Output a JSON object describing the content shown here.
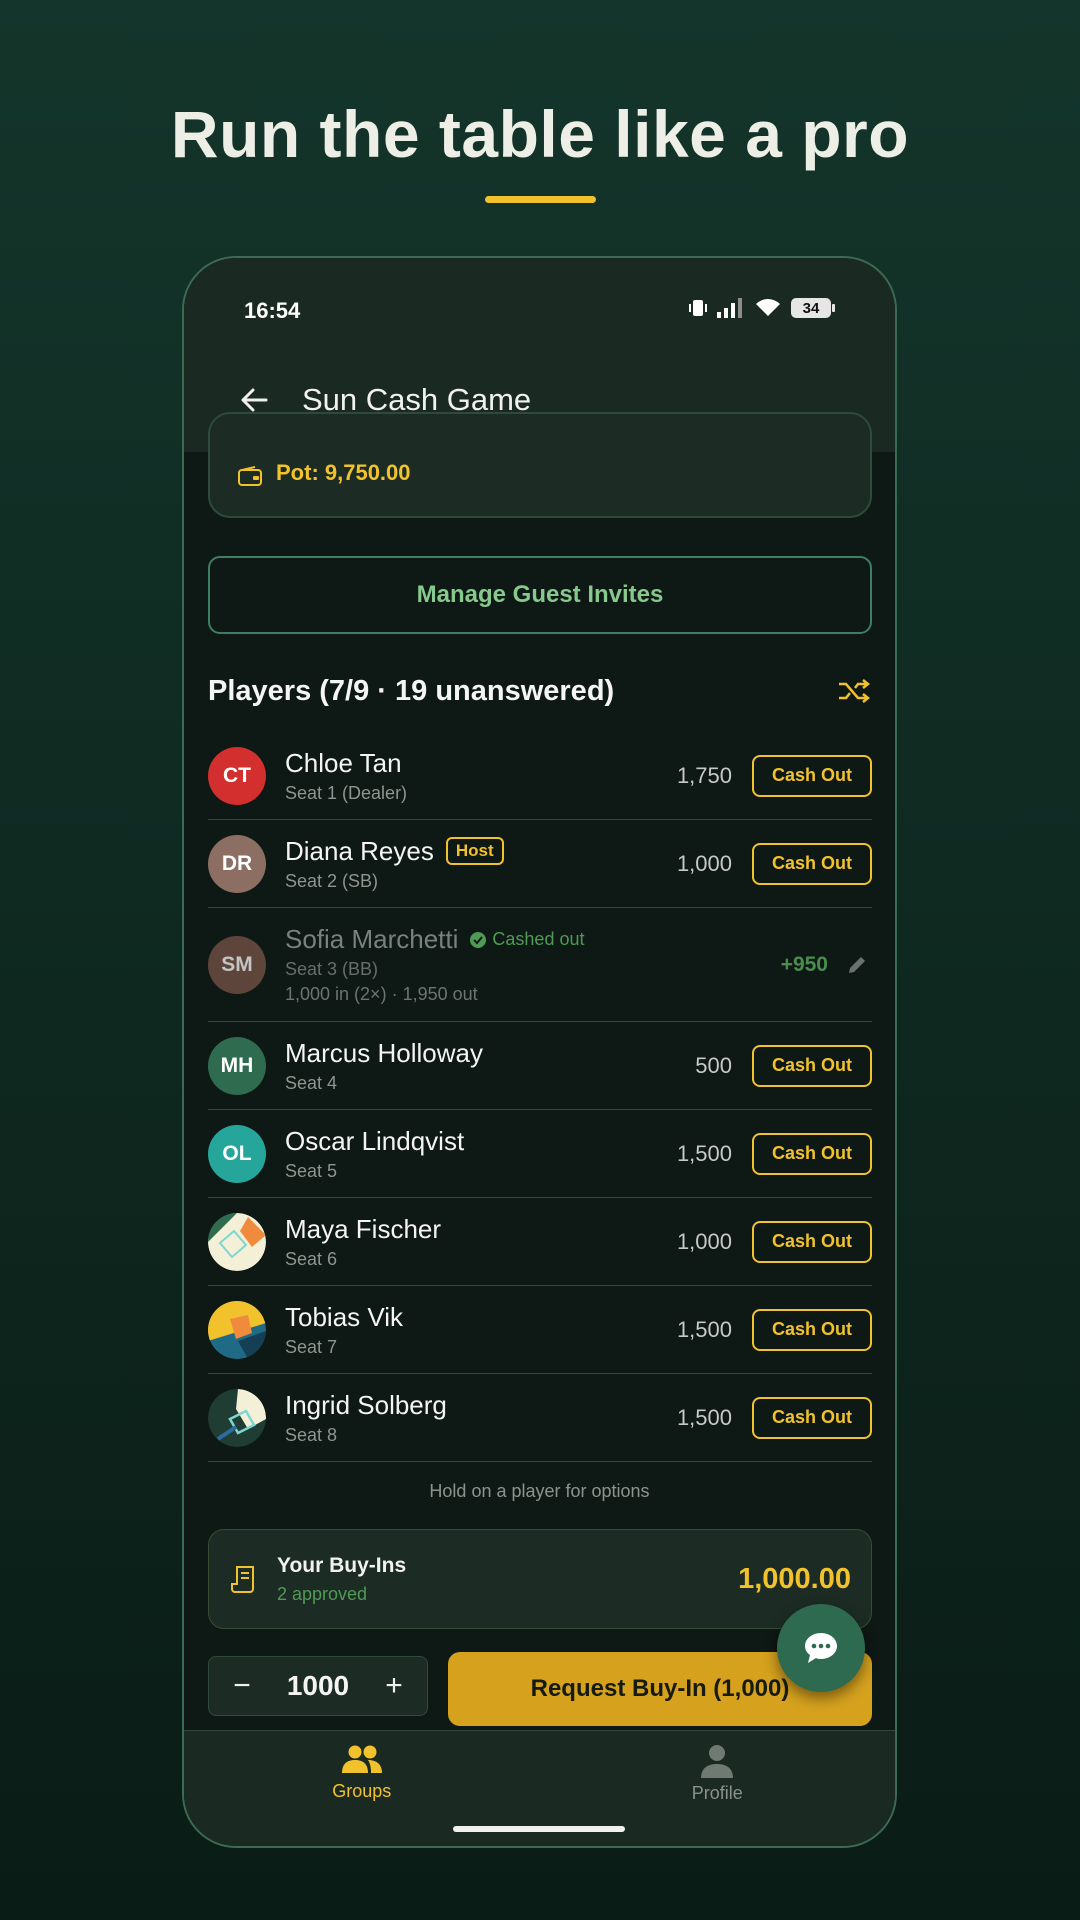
{
  "headline": "Run the table like a pro",
  "colors": {
    "accent": "#f2c22c",
    "green": "#4f9a55",
    "background": "#14352b"
  },
  "status_bar": {
    "time": "16:54",
    "battery": "34"
  },
  "app_bar": {
    "title": "Sun Cash Game",
    "back_icon": "arrow-left-icon"
  },
  "pot": {
    "label": "Pot: 9,750.00",
    "icon": "wallet-icon"
  },
  "manage_guest_invites": "Manage Guest Invites",
  "players": {
    "title": "Players (7/9 · 19 unanswered)",
    "shuffle_icon": "shuffle-icon",
    "cash_out_label": "Cash Out",
    "list": [
      {
        "initials": "CT",
        "name": "Chloe Tan",
        "seat": "Seat 1 (Dealer)",
        "amount": "1,750",
        "avatar_color": "#d32f2f"
      },
      {
        "initials": "DR",
        "name": "Diana Reyes",
        "badge": "Host",
        "seat": "Seat 2 (SB)",
        "amount": "1,000",
        "avatar_color": "#8d6e63"
      },
      {
        "initials": "SM",
        "name": "Sofia Marchetti",
        "status": "Cashed out",
        "seat": "Seat 3 (BB)",
        "detail": "1,000 in (2×) · 1,950 out",
        "gain": "+950",
        "avatar_color": "#795548"
      },
      {
        "initials": "MH",
        "name": "Marcus Holloway",
        "seat": "Seat 4",
        "amount": "500",
        "avatar_color": "#2e6b4f"
      },
      {
        "initials": "OL",
        "name": "Oscar Lindqvist",
        "seat": "Seat 5",
        "amount": "1,500",
        "avatar_color": "#26a69a"
      },
      {
        "initials": "",
        "name": "Maya Fischer",
        "seat": "Seat 6",
        "amount": "1,000",
        "avatar_color": "#f4f0d8"
      },
      {
        "initials": "",
        "name": "Tobias Vik",
        "seat": "Seat 7",
        "amount": "1,500",
        "avatar_color": "#1f6b86"
      },
      {
        "initials": "",
        "name": "Ingrid Solberg",
        "seat": "Seat 8",
        "amount": "1,500",
        "avatar_color": "#1f3d33"
      }
    ]
  },
  "hint": "Hold on a player for options",
  "buy_ins": {
    "title": "Your Buy-Ins",
    "subtitle": "2 approved",
    "total": "1,000.00"
  },
  "stepper": {
    "minus": "−",
    "value": "1000",
    "plus": "+"
  },
  "request_button": "Request Buy-In (1,000)",
  "nav": {
    "groups": "Groups",
    "profile": "Profile"
  }
}
